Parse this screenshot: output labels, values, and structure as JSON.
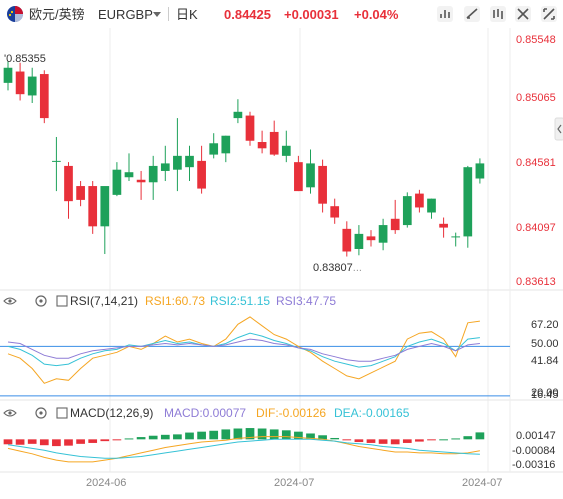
{
  "header": {
    "pair_name": "欧元/英镑",
    "symbol": "EURGBP",
    "timeframe": "日K",
    "price": "0.84425",
    "change": "+0.00031",
    "change_pct": "+0.04%",
    "icons": [
      "flag-eu-gb-icon",
      "chevron-down-icon",
      "indicator-settings-icon",
      "draw-tool-icon",
      "share-icon",
      "fullscreen-icon",
      "settings-icon",
      "expand-icon"
    ]
  },
  "colors": {
    "up": "#1ea15a",
    "down": "#e8303a",
    "price_text": "#e8303a",
    "axis_text": "#e8303a",
    "rsi1": "#f5a623",
    "rsi2": "#36c2d6",
    "rsi3": "#8e7cd6",
    "dif": "#f5a623",
    "dea": "#36c2d6",
    "ref_line": "#3a8ee6",
    "grid": "#eeeeee"
  },
  "rsi_panel": {
    "label": "RSI(7,14,21)",
    "rsi1_label": "RSI1:60.73",
    "rsi2_label": "RSI2:51.15",
    "rsi3_label": "RSI3:47.75",
    "ticks": [
      "67.20",
      "50.00",
      "41.84",
      "20.00",
      "16.45"
    ]
  },
  "macd_panel": {
    "label": "MACD(12,26,9)",
    "macd_label": "MACD:0.00077",
    "dif_label": "DIF:-0.00126",
    "dea_label": "DEA:-0.00165",
    "ticks": [
      "0.00147",
      "-0.00084",
      "-0.00316"
    ]
  },
  "x_ticks": [
    "2024-06",
    "2024-07",
    "2024-07"
  ],
  "chart_data": [
    {
      "type": "candlestick",
      "y_ticks": [
        "0.85548",
        "0.85065",
        "0.84581",
        "0.84097",
        "0.83613"
      ],
      "ylim": [
        0.8355,
        0.856
      ],
      "annotations": {
        "high_label": "0.85355",
        "low_label": "0.83807"
      },
      "candles": [
        {
          "o": 0.8518,
          "h": 0.8535,
          "l": 0.8512,
          "c": 0.853
        },
        {
          "o": 0.8527,
          "h": 0.8534,
          "l": 0.8504,
          "c": 0.8509
        },
        {
          "o": 0.8508,
          "h": 0.853,
          "l": 0.8502,
          "c": 0.8523
        },
        {
          "o": 0.8525,
          "h": 0.8528,
          "l": 0.8486,
          "c": 0.849
        },
        {
          "o": 0.8456,
          "h": 0.8475,
          "l": 0.8432,
          "c": 0.8456
        },
        {
          "o": 0.8452,
          "h": 0.8455,
          "l": 0.841,
          "c": 0.8424
        },
        {
          "o": 0.8436,
          "h": 0.844,
          "l": 0.842,
          "c": 0.8425
        },
        {
          "o": 0.8436,
          "h": 0.844,
          "l": 0.8398,
          "c": 0.8404
        },
        {
          "o": 0.8404,
          "h": 0.8432,
          "l": 0.8382,
          "c": 0.8436
        },
        {
          "o": 0.8429,
          "h": 0.8455,
          "l": 0.8428,
          "c": 0.8449
        },
        {
          "o": 0.8443,
          "h": 0.8462,
          "l": 0.844,
          "c": 0.8447
        },
        {
          "o": 0.8441,
          "h": 0.8448,
          "l": 0.8425,
          "c": 0.8439
        },
        {
          "o": 0.8439,
          "h": 0.846,
          "l": 0.8425,
          "c": 0.8452
        },
        {
          "o": 0.8448,
          "h": 0.8468,
          "l": 0.844,
          "c": 0.8454
        },
        {
          "o": 0.8449,
          "h": 0.849,
          "l": 0.8432,
          "c": 0.846
        },
        {
          "o": 0.8451,
          "h": 0.8468,
          "l": 0.844,
          "c": 0.846
        },
        {
          "o": 0.8456,
          "h": 0.8468,
          "l": 0.843,
          "c": 0.8434
        },
        {
          "o": 0.8461,
          "h": 0.8478,
          "l": 0.8458,
          "c": 0.847
        },
        {
          "o": 0.8462,
          "h": 0.8476,
          "l": 0.8455,
          "c": 0.8476
        },
        {
          "o": 0.849,
          "h": 0.8505,
          "l": 0.8486,
          "c": 0.8495
        },
        {
          "o": 0.8492,
          "h": 0.8495,
          "l": 0.8468,
          "c": 0.8472
        },
        {
          "o": 0.8471,
          "h": 0.848,
          "l": 0.8462,
          "c": 0.8466
        },
        {
          "o": 0.8479,
          "h": 0.8488,
          "l": 0.846,
          "c": 0.8461
        },
        {
          "o": 0.846,
          "h": 0.848,
          "l": 0.8455,
          "c": 0.8468
        },
        {
          "o": 0.8455,
          "h": 0.846,
          "l": 0.8432,
          "c": 0.8432
        },
        {
          "o": 0.8435,
          "h": 0.8465,
          "l": 0.843,
          "c": 0.8454
        },
        {
          "o": 0.8452,
          "h": 0.8457,
          "l": 0.8415,
          "c": 0.8422
        },
        {
          "o": 0.842,
          "h": 0.8426,
          "l": 0.8406,
          "c": 0.8411
        },
        {
          "o": 0.8402,
          "h": 0.8408,
          "l": 0.838,
          "c": 0.8384
        },
        {
          "o": 0.8386,
          "h": 0.8405,
          "l": 0.8381,
          "c": 0.8398
        },
        {
          "o": 0.8396,
          "h": 0.8401,
          "l": 0.8388,
          "c": 0.8393
        },
        {
          "o": 0.8391,
          "h": 0.841,
          "l": 0.8385,
          "c": 0.8405
        },
        {
          "o": 0.841,
          "h": 0.8425,
          "l": 0.8398,
          "c": 0.8401
        },
        {
          "o": 0.8405,
          "h": 0.8431,
          "l": 0.8403,
          "c": 0.8428
        },
        {
          "o": 0.843,
          "h": 0.8433,
          "l": 0.8415,
          "c": 0.8419
        },
        {
          "o": 0.8415,
          "h": 0.8426,
          "l": 0.841,
          "c": 0.8426
        },
        {
          "o": 0.8406,
          "h": 0.8411,
          "l": 0.8395,
          "c": 0.8403
        },
        {
          "o": 0.8396,
          "h": 0.8399,
          "l": 0.8388,
          "c": 0.8396
        },
        {
          "o": 0.8396,
          "h": 0.8452,
          "l": 0.8387,
          "c": 0.8451
        },
        {
          "o": 0.8442,
          "h": 0.8458,
          "l": 0.8438,
          "c": 0.8454
        }
      ]
    },
    {
      "type": "line",
      "series": [
        {
          "name": "RSI1",
          "values": [
            45,
            42,
            35,
            25,
            28,
            27,
            35,
            42,
            44,
            46,
            50,
            48,
            52,
            57,
            53,
            55,
            52,
            50,
            55,
            65,
            70,
            64,
            58,
            55,
            50,
            46,
            40,
            35,
            30,
            28,
            32,
            36,
            40,
            55,
            59,
            60,
            55,
            43,
            66,
            67.2
          ]
        },
        {
          "name": "RSI2",
          "values": [
            50,
            48,
            44,
            38,
            37,
            38,
            42,
            45,
            47,
            48,
            51,
            50,
            52,
            54,
            52,
            53,
            51,
            50,
            52,
            56,
            59,
            57,
            54,
            52,
            49,
            47,
            43,
            40,
            38,
            36,
            37,
            40,
            43,
            50,
            53,
            55,
            52,
            47,
            55,
            56
          ]
        },
        {
          "name": "RSI3",
          "values": [
            53,
            52,
            48,
            44,
            42,
            42,
            45,
            47,
            48,
            49,
            50,
            50,
            51,
            52,
            51,
            52,
            51,
            50,
            51,
            53,
            55,
            54,
            52,
            51,
            49,
            48,
            45,
            43,
            41,
            40,
            40,
            42,
            44,
            48,
            50,
            52,
            50,
            47,
            51,
            52
          ]
        }
      ],
      "ylim": [
        15,
        72
      ],
      "ref_lines": [
        50,
        16.45
      ]
    },
    {
      "type": "bar",
      "series": [
        {
          "name": "MACD",
          "values": [
            -0.00055,
            -0.0006,
            -0.0005,
            -0.00065,
            -0.00075,
            -0.0007,
            -0.0005,
            -0.0004,
            -0.0002,
            -5e-05,
            0.0001,
            0.00025,
            0.0004,
            0.0005,
            0.00055,
            0.00075,
            0.00085,
            0.00095,
            0.0011,
            0.0012,
            0.00125,
            0.0012,
            0.0011,
            0.001,
            0.00085,
            0.00065,
            0.00045,
            0.00015,
            -0.0001,
            -0.0003,
            -0.0004,
            -0.0005,
            -0.00055,
            -0.0004,
            -0.00025,
            -0.0001,
            0.0,
            0.0001,
            0.00035,
            0.00077
          ]
        },
        {
          "name": "DIF",
          "values": [
            -0.001,
            -0.0013,
            -0.0016,
            -0.002,
            -0.0023,
            -0.0025,
            -0.0025,
            -0.0025,
            -0.0023,
            -0.0021,
            -0.0018,
            -0.0015,
            -0.0012,
            -0.0009,
            -0.0007,
            -0.0005,
            -0.0003,
            -0.0002,
            -0.0001,
            0.0001,
            0.0002,
            0.0003,
            0.0003,
            0.0003,
            0.0002,
            0.0001,
            0.0,
            -0.0002,
            -0.0005,
            -0.0008,
            -0.001,
            -0.0012,
            -0.0014,
            -0.0014,
            -0.0015,
            -0.0015,
            -0.0016,
            -0.0016,
            -0.0015,
            -0.00126
          ]
        },
        {
          "name": "DEA",
          "values": [
            -0.0006,
            -0.0008,
            -0.001,
            -0.0012,
            -0.0015,
            -0.0017,
            -0.0019,
            -0.002,
            -0.0021,
            -0.0021,
            -0.002,
            -0.0019,
            -0.0017,
            -0.0015,
            -0.0013,
            -0.0011,
            -0.0009,
            -0.0007,
            -0.0005,
            -0.0003,
            -0.0002,
            -0.0001,
            0.0,
            0.0,
            0.0,
            0.0,
            -0.0001,
            -0.0002,
            -0.0004,
            -0.0005,
            -0.0006,
            -0.0008,
            -0.0009,
            -0.001,
            -0.0012,
            -0.0013,
            -0.0014,
            -0.0015,
            -0.0016,
            -0.00165
          ]
        }
      ],
      "ylim": [
        -0.0034,
        0.0017
      ]
    }
  ]
}
